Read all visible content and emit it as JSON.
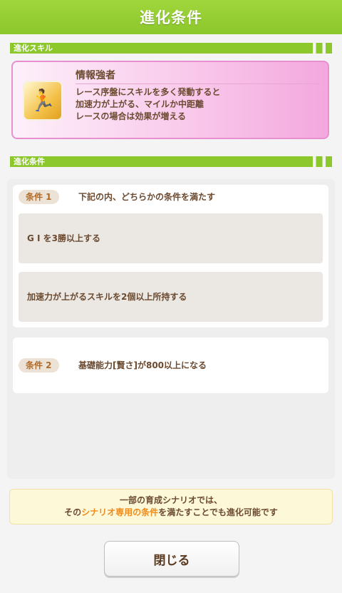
{
  "dialog_title": "進化条件",
  "skill_section": {
    "label": "進化スキル"
  },
  "skill": {
    "icon": "running-figure-icon",
    "name": "情報強者",
    "description_lines": [
      "レース序盤にスキルを多く発動すると",
      "加速力が上がる、マイルか中距離",
      "レースの場合は効果が増える"
    ]
  },
  "conditions_section": {
    "label": "進化条件"
  },
  "conditions": [
    {
      "tag": "条件 1",
      "text": "下記の内、どちらかの条件を満たす",
      "options": [
        "G I を3勝以上する",
        "加速力が上がるスキルを2個以上所持する"
      ]
    },
    {
      "tag": "条件 2",
      "text": "基礎能力[賢さ]が800以上になる"
    }
  ],
  "note": {
    "line1": "一部の育成シナリオでは、",
    "line2_prefix": "その",
    "line2_highlight": "シナリオ専用の条件",
    "line2_suffix": "を満たすことでも進化可能です"
  },
  "close_button": "閉じる",
  "colors": {
    "header": "#8cc72c",
    "accent": "#f08a1a",
    "text": "#6b4a30"
  }
}
